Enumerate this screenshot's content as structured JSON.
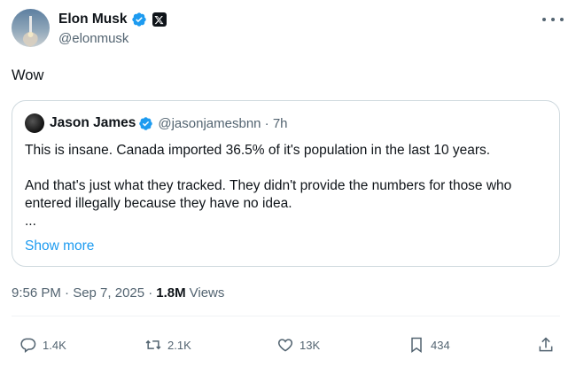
{
  "author": {
    "name": "Elon Musk",
    "handle": "@elonmusk",
    "affiliate_badge": "x-logo-icon",
    "verified_color": "#1d9bf0"
  },
  "tweet": {
    "text": "Wow",
    "time": "9:56 PM · Sep 7, 2025 ·",
    "views_count": "1.8M",
    "views_label": "Views"
  },
  "quote": {
    "name": "Jason James",
    "handle_time": "@jasonjamesbnn · 7h",
    "line1": "This is insane. Canada imported 36.5% of it's population in the last 10 years.",
    "line2": "And that's just what they tracked. They didn't provide the numbers for those who entered illegally because they have no idea.",
    "ellipsis": "...",
    "show_more": "Show more"
  },
  "actions": {
    "replies": "1.4K",
    "reposts": "2.1K",
    "likes": "13K",
    "bookmarks": "434"
  },
  "colors": {
    "text": "#0f1419",
    "secondary": "#536471",
    "accent": "#1d9bf0",
    "border": "#cfd9de"
  }
}
